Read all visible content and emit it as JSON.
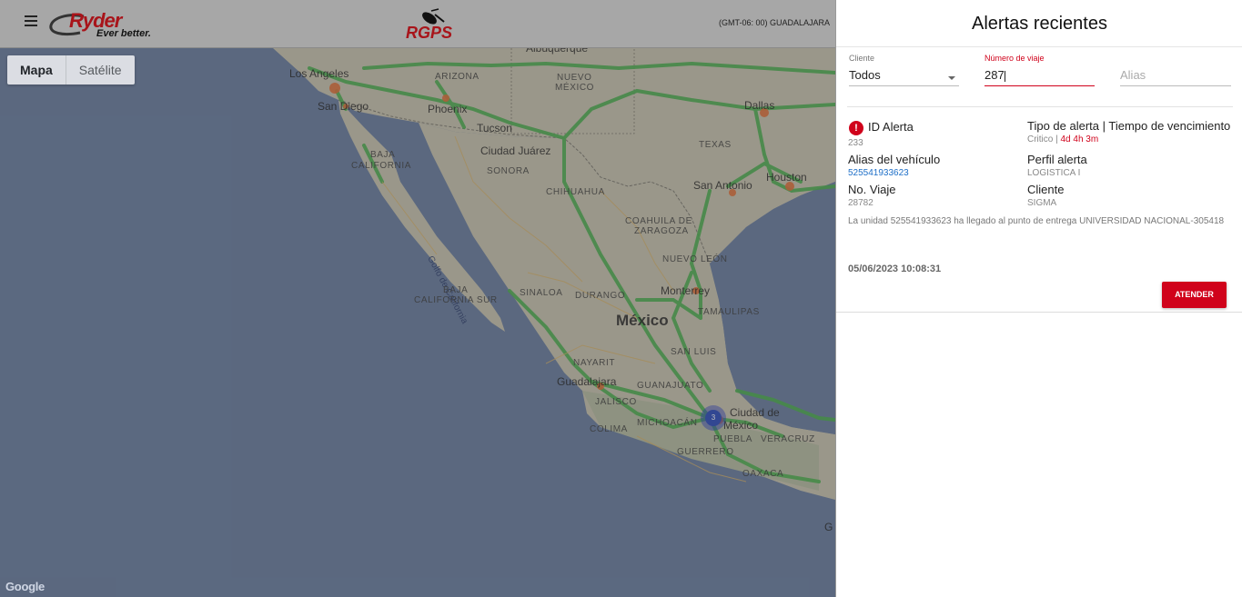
{
  "header": {
    "brand_word": "Ryder",
    "brand_tagline": "Ever better.",
    "product_logo_text": "RGPS",
    "timezone": "(GMT-06: 00) GUADALAJARA"
  },
  "map": {
    "type_selected": "Mapa",
    "type_other": "Satélite",
    "attribution": "Google",
    "cluster_count": "3",
    "labels": {
      "los_angeles": "Los Angeles",
      "san_diego": "San Diego",
      "phoenix": "Phoenix",
      "arizona": "ARIZONA",
      "albuquerque": "Albuquerque",
      "nuevo_mexico_1": "NUEVO",
      "nuevo_mexico_2": "MÉXICO",
      "tucson": "Tucson",
      "ciudad_juarez": "Ciudad Juárez",
      "dallas": "Dallas",
      "texas": "TEXAS",
      "houston": "Houston",
      "san_antonio": "San Antonio",
      "baja_california_1": "BAJA",
      "baja_california_2": "CALIFORNIA",
      "sonora": "SONORA",
      "chihuahua": "CHIHUAHUA",
      "coahuila_1": "COAHUILA DE",
      "coahuila_2": "ZARAGOZA",
      "nuevo_leon": "NUEVO LEÓN",
      "golfo": "Golfo de California",
      "bcs_1": "BAJA",
      "bcs_2": "CALIFORNIA SUR",
      "sinaloa": "SINALOA",
      "durango": "DURANGO",
      "monterrey": "Monterrey",
      "tamaulipas": "TAMAULIPAS",
      "mexico": "México",
      "san_luis": "SAN LUIS",
      "nayarit": "NAYARIT",
      "guadalajara": "Guadalajara",
      "jalisco": "JALISCO",
      "guanajuato": "GUANAJUATO",
      "colima": "COLIMA",
      "michoacan": "MICHOACÁN",
      "cdmx_1": "Ciudad de",
      "cdmx_2": "México",
      "puebla": "PUEBLA",
      "veracruz": "VERACRUZ",
      "guerrero": "GUERRERO",
      "oaxaca": "OAXACA",
      "edge_g": "G"
    }
  },
  "panel": {
    "title": "Alertas recientes",
    "filters": {
      "cliente_label": "Cliente",
      "cliente_value": "Todos",
      "viaje_label": "Número de viaje",
      "viaje_value": "287",
      "alias_placeholder": "Alias"
    },
    "alert": {
      "id_label": "ID Alerta",
      "id_value": "233",
      "tipo_label": "Tipo de alerta | Tiempo de vencimiento",
      "tipo_value": "Critico",
      "tipo_sep": " | ",
      "tiempo_value": "4d 4h 3m",
      "alias_label": "Alias del vehículo",
      "alias_value": "525541933623",
      "perfil_label": "Perfil alerta",
      "perfil_value": "LOGISTICA I",
      "viaje_label": "No. Viaje",
      "viaje_value": "28782",
      "cliente_label": "Cliente",
      "cliente_value": "SIGMA",
      "message": "La unidad 525541933623 ha llegado al punto de entrega UNIVERSIDAD NACIONAL-305418",
      "datetime": "05/06/2023 10:08:31",
      "action_label": "ATENDER"
    }
  },
  "colors": {
    "brand_red": "#d0021b",
    "link_blue": "#1e6fc8",
    "ocean": "#6a7ea0",
    "land": "#c9c4b2",
    "highway": "#4caf50"
  }
}
